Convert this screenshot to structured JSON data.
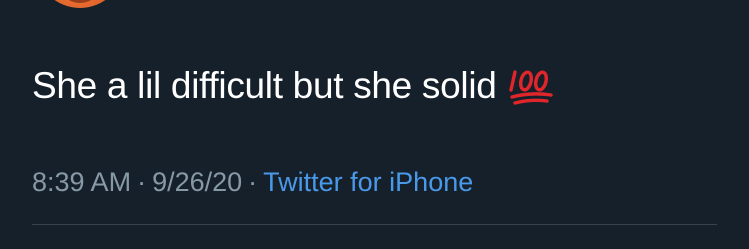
{
  "tweet": {
    "text": "She a lil difficult but she solid",
    "emoji_icon": "hundred-points-emoji",
    "time": "8:39 AM",
    "separator": "·",
    "date": "9/26/20",
    "source": "Twitter for iPhone"
  },
  "colors": {
    "background": "#15202b",
    "text": "#ffffff",
    "meta": "#8899a6",
    "link": "#4a99e9",
    "divider": "#38444d",
    "emoji": "#e0262b"
  }
}
